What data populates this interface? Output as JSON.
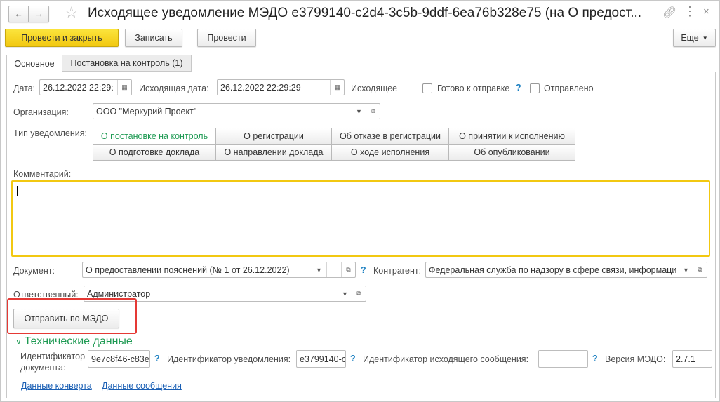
{
  "title": "Исходящее уведомление МЭДО e3799140-c2d4-3c5b-9ddf-6ea76b328e75 (на О предост...",
  "toolbar": {
    "post_close": "Провести и закрыть",
    "save": "Записать",
    "post": "Провести",
    "more": "Еще"
  },
  "tabs": [
    {
      "label": "Основное",
      "active": true
    },
    {
      "label": "Постановка на контроль (1)",
      "active": false
    }
  ],
  "form": {
    "date_label": "Дата:",
    "date_value": "26.12.2022 22:29:",
    "out_date_label": "Исходящая дата:",
    "out_date_value": "26.12.2022 22:29:29",
    "direction": "Исходящее",
    "ready_label": "Готово к отправке",
    "ready_checked": false,
    "sent_label": "Отправлено",
    "sent_checked": false,
    "org_label": "Организация:",
    "org_value": "ООО \"Меркурий Проект\"",
    "type_label": "Тип уведомления:",
    "types": [
      "О постановке на контроль",
      "О регистрации",
      "Об отказе в регистрации",
      "О принятии к исполнению",
      "О подготовке доклада",
      "О направлении доклада",
      "О ходе исполнения",
      "Об опубликовании"
    ],
    "selected_type": "О постановке на контроль",
    "comment_label": "Комментарий:",
    "comment_value": "",
    "doc_label": "Документ:",
    "doc_value": "О предоставлении пояснений (№ 1 от 26.12.2022)",
    "contr_label": "Контрагент:",
    "contr_value": "Федеральная служба по надзору в сфере связи, информаци",
    "resp_label": "Ответственный:",
    "resp_value": "Администратор",
    "send_button": "Отправить по МЭДО",
    "tech_title": "Технические данные",
    "doc_id_label": "Идентификатор документа:",
    "doc_id_value": "9e7c8f46-c83e",
    "notif_id_label": "Идентификатор уведомления:",
    "notif_id_value": "e3799140-c",
    "msg_id_label": "Идентификатор исходящего сообщения:",
    "msg_id_value": "",
    "version_label": "Версия МЭДО:",
    "version_value": "2.7.1",
    "link_envelope": "Данные конверта",
    "link_message": "Данные сообщения",
    "help": "?"
  },
  "colors": {
    "accent_yellow": "#f2c811",
    "highlight_red": "#e53935",
    "green": "#1e9a53",
    "link": "#1a5fb4"
  }
}
